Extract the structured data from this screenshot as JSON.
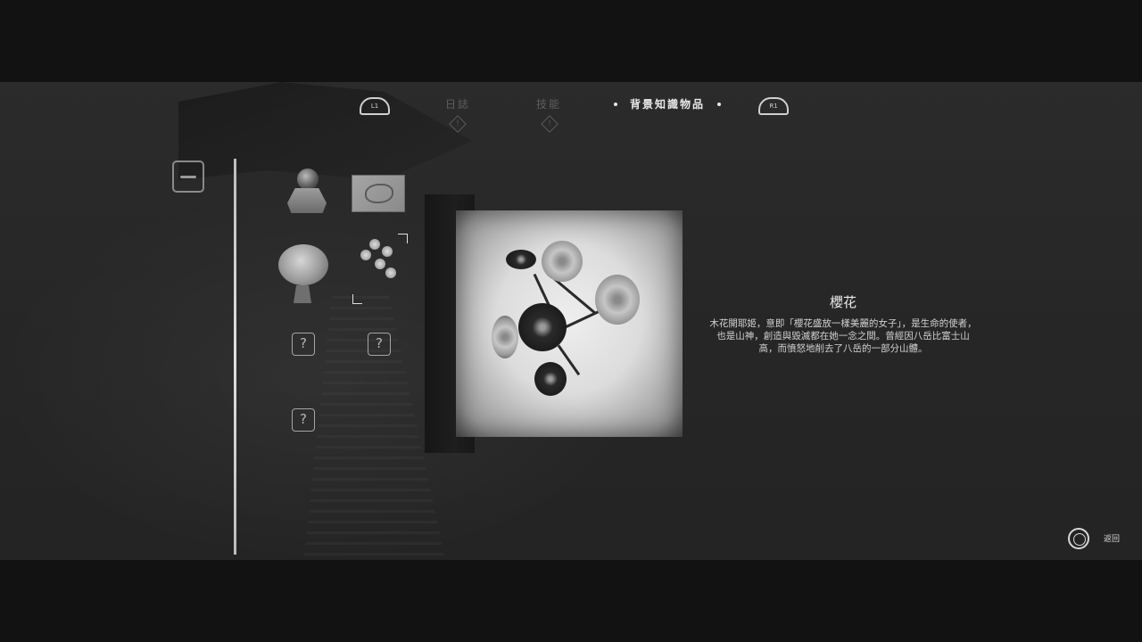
{
  "header": {
    "left_shoulder": "L1",
    "right_shoulder": "R1",
    "tabs": [
      {
        "label": "日誌",
        "alert": true
      },
      {
        "label": "技能",
        "alert": true
      },
      {
        "label": "背景知識物品",
        "active": true
      }
    ]
  },
  "sidebar": {
    "category_icon": "key-icon"
  },
  "items": [
    {
      "icon": "shrine-orb-icon",
      "known": true
    },
    {
      "icon": "fish-drawing-icon",
      "known": true
    },
    {
      "icon": "seashell-icon",
      "known": true
    },
    {
      "icon": "cherry-blossom-icon",
      "known": true,
      "selected": true
    },
    {
      "label": "?",
      "known": false
    },
    {
      "label": "?",
      "known": false
    },
    {
      "label": "?",
      "known": false
    }
  ],
  "detail": {
    "title": "櫻花",
    "body": "木花開耶姬，意即「櫻花盛放一樣美麗的女子」，是生命的使者，也是山神，創造與毀滅都在她一念之間。曾經因八岳比富士山高，而憤怒地削去了八岳的一部分山體。"
  },
  "footer": {
    "back_label": "返回"
  }
}
